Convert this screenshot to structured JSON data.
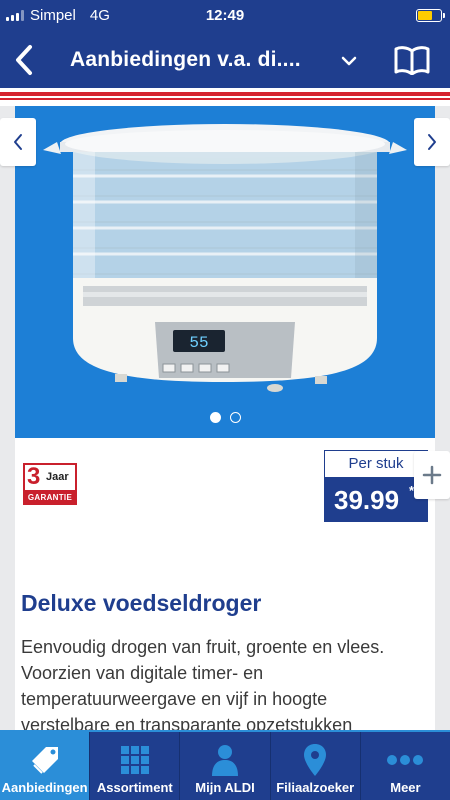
{
  "status_bar": {
    "carrier": "Simpel",
    "network": "4G",
    "time": "12:49"
  },
  "nav": {
    "title": "Aanbiedingen v.a. di....",
    "back_icon": "chevron-left-icon",
    "dropdown_icon": "chevron-down-icon",
    "book_icon": "book-icon"
  },
  "product": {
    "badge": {
      "number": "3",
      "unit": "Jaar",
      "label": "GARANTIE"
    },
    "price_unit": "Per stuk",
    "price": "39.99",
    "price_marker": "*",
    "title": "Deluxe voedseldroger",
    "description": "Eenvoudig drogen van fruit, groente en vlees. Voorzien van digitale timer- en temperatuurweergave en vijf in hoogte verstelbare en transparante opzetstukken",
    "display_readout": "55",
    "carousel": {
      "count": 2,
      "active_index": 0
    }
  },
  "tabs": [
    {
      "label": "Aanbiedingen",
      "icon": "tag-icon",
      "active": true
    },
    {
      "label": "Assortiment",
      "icon": "grid-icon",
      "active": false
    },
    {
      "label": "Mijn ALDI",
      "icon": "person-icon",
      "active": false
    },
    {
      "label": "Filiaalzoeker",
      "icon": "location-pin-icon",
      "active": false
    },
    {
      "label": "Meer",
      "icon": "more-dots-icon",
      "active": false
    }
  ],
  "colors": {
    "brand_blue": "#1f3e8e",
    "accent_blue": "#2b8ed8",
    "hero_blue": "#1d7fd6",
    "stripe_red": "#d5232f",
    "battery_level_low": "#ffcc00"
  }
}
